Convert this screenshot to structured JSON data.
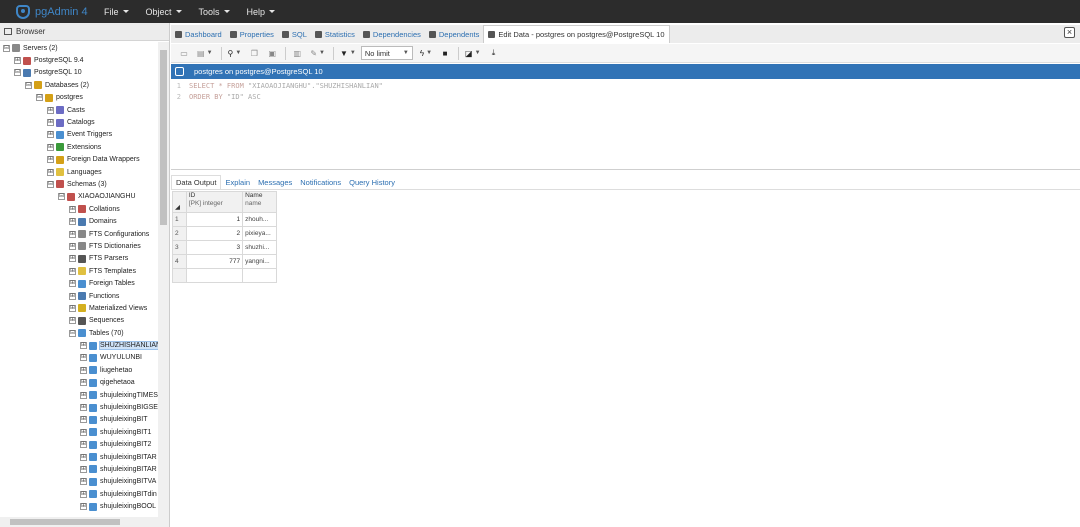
{
  "app": {
    "title": "pgAdmin 4"
  },
  "menu": [
    {
      "label": "File"
    },
    {
      "label": "Object"
    },
    {
      "label": "Tools"
    },
    {
      "label": "Help"
    }
  ],
  "browser": {
    "title": "Browser"
  },
  "tree": [
    {
      "label": "Servers (2)",
      "depth": 0,
      "toggle": "⊟",
      "icon_color": "#888888"
    },
    {
      "label": "PostgreSQL 9.4",
      "depth": 1,
      "toggle": "⊞",
      "icon_color": "#c0504d"
    },
    {
      "label": "PostgreSQL 10",
      "depth": 1,
      "toggle": "⊟",
      "icon_color": "#4a7ab0"
    },
    {
      "label": "Databases (2)",
      "depth": 2,
      "toggle": "⊟",
      "icon_color": "#d4a017"
    },
    {
      "label": "postgres",
      "depth": 3,
      "toggle": "⊟",
      "icon_color": "#d4a017"
    },
    {
      "label": "Casts",
      "depth": 4,
      "toggle": "⊞",
      "icon_color": "#6c6cc4"
    },
    {
      "label": "Catalogs",
      "depth": 4,
      "toggle": "⊞",
      "icon_color": "#6c6cc4"
    },
    {
      "label": "Event Triggers",
      "depth": 4,
      "toggle": "⊞",
      "icon_color": "#4a8fd0"
    },
    {
      "label": "Extensions",
      "depth": 4,
      "toggle": "⊞",
      "icon_color": "#3a9a3a"
    },
    {
      "label": "Foreign Data Wrappers",
      "depth": 4,
      "toggle": "⊞",
      "icon_color": "#d4a017"
    },
    {
      "label": "Languages",
      "depth": 4,
      "toggle": "⊞",
      "icon_color": "#e0c040"
    },
    {
      "label": "Schemas (3)",
      "depth": 4,
      "toggle": "⊟",
      "icon_color": "#c0504d"
    },
    {
      "label": "XIAOAOJIANGHU",
      "depth": 5,
      "toggle": "⊟",
      "icon_color": "#c0504d"
    },
    {
      "label": "Collations",
      "depth": 6,
      "toggle": "⊞",
      "icon_color": "#c0504d"
    },
    {
      "label": "Domains",
      "depth": 6,
      "toggle": "⊞",
      "icon_color": "#4a7ab0"
    },
    {
      "label": "FTS Configurations",
      "depth": 6,
      "toggle": "⊞",
      "icon_color": "#888888"
    },
    {
      "label": "FTS Dictionaries",
      "depth": 6,
      "toggle": "⊞",
      "icon_color": "#888888"
    },
    {
      "label": "FTS Parsers",
      "depth": 6,
      "toggle": "⊞",
      "icon_color": "#555555"
    },
    {
      "label": "FTS Templates",
      "depth": 6,
      "toggle": "⊞",
      "icon_color": "#e0c040"
    },
    {
      "label": "Foreign Tables",
      "depth": 6,
      "toggle": "⊞",
      "icon_color": "#4a8fd0"
    },
    {
      "label": "Functions",
      "depth": 6,
      "toggle": "⊞",
      "icon_color": "#4a7ab0"
    },
    {
      "label": "Materialized Views",
      "depth": 6,
      "toggle": "⊞",
      "icon_color": "#d4b020"
    },
    {
      "label": "Sequences",
      "depth": 6,
      "toggle": "⊞",
      "icon_color": "#555555"
    },
    {
      "label": "Tables (70)",
      "depth": 6,
      "toggle": "⊟",
      "icon_color": "#4a8fd0"
    },
    {
      "label": "SHUZHISHANLIAN",
      "depth": 7,
      "toggle": "⊞",
      "icon_color": "#4a8fd0",
      "selected": true
    },
    {
      "label": "WUYULUNBI",
      "depth": 7,
      "toggle": "⊞",
      "icon_color": "#4a8fd0"
    },
    {
      "label": "liugehetao",
      "depth": 7,
      "toggle": "⊞",
      "icon_color": "#4a8fd0"
    },
    {
      "label": "qigehetaoa",
      "depth": 7,
      "toggle": "⊞",
      "icon_color": "#4a8fd0"
    },
    {
      "label": "shujuleixingTIMES",
      "depth": 7,
      "toggle": "⊞",
      "icon_color": "#4a8fd0"
    },
    {
      "label": "shujuleixingBIGSE",
      "depth": 7,
      "toggle": "⊞",
      "icon_color": "#4a8fd0"
    },
    {
      "label": "shujuleixingBIT",
      "depth": 7,
      "toggle": "⊞",
      "icon_color": "#4a8fd0"
    },
    {
      "label": "shujuleixingBIT1",
      "depth": 7,
      "toggle": "⊞",
      "icon_color": "#4a8fd0"
    },
    {
      "label": "shujuleixingBIT2",
      "depth": 7,
      "toggle": "⊞",
      "icon_color": "#4a8fd0"
    },
    {
      "label": "shujuleixingBITAR",
      "depth": 7,
      "toggle": "⊞",
      "icon_color": "#4a8fd0"
    },
    {
      "label": "shujuleixingBITAR",
      "depth": 7,
      "toggle": "⊞",
      "icon_color": "#4a8fd0"
    },
    {
      "label": "shujuleixingBITVA",
      "depth": 7,
      "toggle": "⊞",
      "icon_color": "#4a8fd0"
    },
    {
      "label": "shujuleixingBITdin",
      "depth": 7,
      "toggle": "⊞",
      "icon_color": "#4a8fd0"
    },
    {
      "label": "shujuleixingBOOL",
      "depth": 7,
      "toggle": "⊞",
      "icon_color": "#4a8fd0"
    }
  ],
  "tabs": [
    {
      "label": "Dashboard",
      "icon": "dashboard-icon"
    },
    {
      "label": "Properties",
      "icon": "properties-icon"
    },
    {
      "label": "SQL",
      "icon": "sql-icon"
    },
    {
      "label": "Statistics",
      "icon": "statistics-icon"
    },
    {
      "label": "Dependencies",
      "icon": "dependencies-icon"
    },
    {
      "label": "Dependents",
      "icon": "dependents-icon"
    },
    {
      "label": "Edit Data - postgres on postgres@PostgreSQL 10",
      "icon": "lightning-icon",
      "active": true
    }
  ],
  "close_label": "×",
  "toolbar": {
    "limit_label": "No limit"
  },
  "connection": {
    "label": "postgres on postgres@PostgreSQL 10"
  },
  "editor": {
    "lines": [
      {
        "num": "1",
        "kw": "SELECT * FROM ",
        "rest": "\"XIAOAOJIANGHU\".\"SHUZHISHANLIAN\""
      },
      {
        "num": "2",
        "kw": "ORDER BY ",
        "rest": "\"ID\" ASC"
      }
    ]
  },
  "result_tabs": [
    {
      "label": "Data Output",
      "active": true
    },
    {
      "label": "Explain"
    },
    {
      "label": "Messages"
    },
    {
      "label": "Notifications"
    },
    {
      "label": "Query History"
    }
  ],
  "grid": {
    "columns": [
      {
        "name": "ID",
        "type": "[PK] integer"
      },
      {
        "name": "Name",
        "type": "name"
      }
    ],
    "rows": [
      {
        "n": "1",
        "id": "1",
        "name": "zhouh..."
      },
      {
        "n": "2",
        "id": "2",
        "name": "pixieya..."
      },
      {
        "n": "3",
        "id": "3",
        "name": "shuzhi..."
      },
      {
        "n": "4",
        "id": "777",
        "name": "yangni..."
      }
    ]
  }
}
